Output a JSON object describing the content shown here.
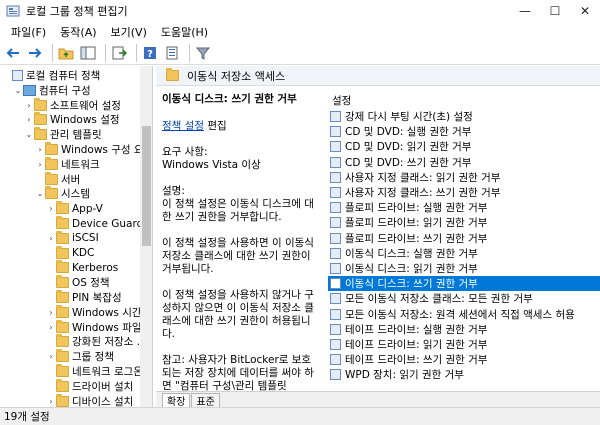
{
  "window": {
    "title": "로컬 그룹 정책 편집기",
    "minimize": "—",
    "maximize": "☐",
    "close": "✕"
  },
  "menu": [
    {
      "label": "파일(F)"
    },
    {
      "label": "동작(A)"
    },
    {
      "label": "보기(V)"
    },
    {
      "label": "도움말(H)"
    }
  ],
  "toolbar_icons": [
    "back-arrow-icon",
    "forward-arrow-icon",
    "up-folder-icon",
    "show-hide-tree-icon",
    "export-list-icon",
    "help-icon",
    "properties-icon",
    "filter-icon"
  ],
  "tree": {
    "items": [
      {
        "label": "로컬 컴퓨터 정책",
        "icon": "doc",
        "exp": "",
        "indent": 0
      },
      {
        "label": "컴퓨터 구성",
        "icon": "pc",
        "exp": "⌄",
        "indent": 1
      },
      {
        "label": "소프트웨어 설정",
        "icon": "folder",
        "exp": "›",
        "indent": 2
      },
      {
        "label": "Windows 설정",
        "icon": "folder",
        "exp": "›",
        "indent": 2
      },
      {
        "label": "관리 템플릿",
        "icon": "folder",
        "exp": "⌄",
        "indent": 2
      },
      {
        "label": "Windows 구성 요소",
        "icon": "folder",
        "exp": "›",
        "indent": 3
      },
      {
        "label": "네트워크",
        "icon": "folder",
        "exp": "›",
        "indent": 3
      },
      {
        "label": "서버",
        "icon": "folder",
        "exp": "",
        "indent": 3
      },
      {
        "label": "시스템",
        "icon": "folder",
        "exp": "⌄",
        "indent": 3
      },
      {
        "label": "App-V",
        "icon": "folder",
        "exp": "›",
        "indent": 4
      },
      {
        "label": "Device Guard",
        "icon": "folder",
        "exp": "",
        "indent": 4
      },
      {
        "label": "iSCSI",
        "icon": "folder",
        "exp": "›",
        "indent": 4
      },
      {
        "label": "KDC",
        "icon": "folder",
        "exp": "",
        "indent": 4
      },
      {
        "label": "Kerberos",
        "icon": "folder",
        "exp": "",
        "indent": 4
      },
      {
        "label": "OS 정책",
        "icon": "folder",
        "exp": "",
        "indent": 4
      },
      {
        "label": "PIN 복잡성",
        "icon": "folder",
        "exp": "",
        "indent": 4
      },
      {
        "label": "Windows 시간 ...",
        "icon": "folder",
        "exp": "›",
        "indent": 4
      },
      {
        "label": "Windows 파일 ...",
        "icon": "folder",
        "exp": "›",
        "indent": 4
      },
      {
        "label": "강화된 저장소 ...",
        "icon": "folder",
        "exp": "",
        "indent": 4
      },
      {
        "label": "그룹 정책",
        "icon": "folder",
        "exp": "›",
        "indent": 4
      },
      {
        "label": "네트워크 로그온",
        "icon": "folder",
        "exp": "",
        "indent": 4
      },
      {
        "label": "드라이버 설치",
        "icon": "folder",
        "exp": "",
        "indent": 4
      },
      {
        "label": "디바이스 설치",
        "icon": "folder",
        "exp": "›",
        "indent": 4
      }
    ]
  },
  "content": {
    "header": "이동식 저장소 액세스",
    "description": {
      "policy_title": "이동식 디스크: 쓰기 권한 거부",
      "edit_link": "정책 설정",
      "edit_suffix": " 편집",
      "requirements": "요구 사항:\nWindows Vista 이상",
      "explanation": "설명:\n이 정책 설정은 이동식 디스크에 대한 쓰기 권한을 거부합니다.",
      "enabled": "이 정책 설정을 사용하면 이 이동식 저장소 클래스에 대한 쓰기 권한이 거부됩니다.",
      "disabled": "이 정책 설정을 사용하지 않거나 구성하지 않으면 이 이동식 저장소 클래스에 대한 쓰기 권한이 허용됩니다.",
      "note": "참고: 사용자가 BitLocker로 보호되는 저장 장치에 데이터를 써야 하면 \"컴퓨터 구성\\관리 템플릿\\Windows 구성 요소\\BitLocker 드라이브 암호화\\이동식 디스크"
    },
    "list_header": "설정",
    "selected_index": 12,
    "settings": [
      "강제 다시 부팅 시간(초) 설정",
      "CD 및 DVD: 실행 권한 거부",
      "CD 및 DVD: 읽기 권한 거부",
      "CD 및 DVD: 쓰기 권한 거부",
      "사용자 지정 클래스: 읽기 권한 거부",
      "사용자 지정 클래스: 쓰기 권한 거부",
      "플로피 드라이브: 실행 권한 거부",
      "플로피 드라이브: 읽기 권한 거부",
      "플로피 드라이브: 쓰기 권한 거부",
      "이동식 디스크: 실행 권한 거부",
      "이동식 디스크: 읽기 권한 거부",
      "이동식 디스크: 쓰기 권한 거부",
      "모든 이동식 저장소 클래스: 모든 권한 거부",
      "모든 이동식 저장소: 원격 세션에서 직접 액세스 허용",
      "테이프 드라이브: 실행 권한 거부",
      "테이프 드라이브: 읽기 권한 거부",
      "테이프 드라이브: 쓰기 권한 거부",
      "WPD 장치: 읽기 권한 거부"
    ],
    "tabs": [
      {
        "label": "확장",
        "active": true
      },
      {
        "label": "표준",
        "active": false
      }
    ]
  },
  "status": {
    "text": "19개 설정"
  },
  "colors": {
    "selection": "#0078d7",
    "folder": "#f2c55c"
  }
}
